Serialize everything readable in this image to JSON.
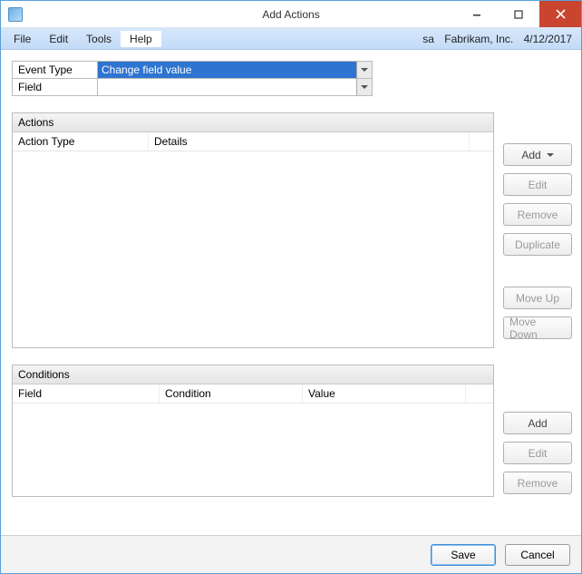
{
  "window": {
    "title": "Add Actions"
  },
  "menubar": {
    "file": "File",
    "edit": "Edit",
    "tools": "Tools",
    "help": "Help",
    "user": "sa",
    "company": "Fabrikam, Inc.",
    "date": "4/12/2017"
  },
  "form": {
    "event_type_label": "Event Type",
    "event_type_value": "Change field value",
    "field_label": "Field",
    "field_value": ""
  },
  "actions_panel": {
    "title": "Actions",
    "columns": {
      "action_type": "Action Type",
      "details": "Details"
    },
    "rows": []
  },
  "conditions_panel": {
    "title": "Conditions",
    "columns": {
      "field": "Field",
      "condition": "Condition",
      "value": "Value"
    },
    "rows": []
  },
  "buttons": {
    "add": "Add",
    "edit": "Edit",
    "remove": "Remove",
    "duplicate": "Duplicate",
    "move_up": "Move Up",
    "move_down": "Move Down",
    "save": "Save",
    "cancel": "Cancel"
  }
}
